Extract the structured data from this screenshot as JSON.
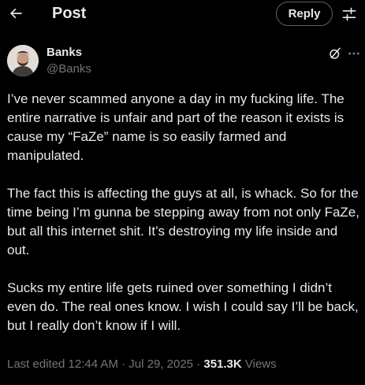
{
  "header": {
    "title": "Post",
    "back_icon": "arrow-left-icon",
    "reply_label": "Reply",
    "settings_icon": "sliders-icon"
  },
  "author": {
    "display_name": "Banks",
    "handle": "@Banks",
    "avatar_icon": "avatar-photo",
    "grok_icon": "grok-icon",
    "more_icon": "more-dots-icon"
  },
  "tweet": {
    "paragraphs": [
      "I’ve never scammed anyone a day in my fucking life. The entire narrative is unfair and part of the reason it exists is cause my “FaZe” name is so easily farmed and manipulated.",
      "The fact this is affecting the guys at all, is whack. So for the time being I’m gunna be stepping away from not only FaZe, but all this internet shit. It’s destroying my life inside and out.",
      "Sucks my entire life gets ruined over something I didn’t even do. The real ones know. I wish I could say I’ll be back, but I really don’t know if I will."
    ]
  },
  "meta": {
    "edited_label": "Last edited 12:44 AM",
    "separator": " · ",
    "date": "Jul 29, 2025",
    "views_count": "351.3K",
    "views_label": " Views"
  },
  "colors": {
    "background": "#000000",
    "primary_text": "#e7e9ea",
    "secondary_text": "#71767b",
    "border": "#536471"
  }
}
